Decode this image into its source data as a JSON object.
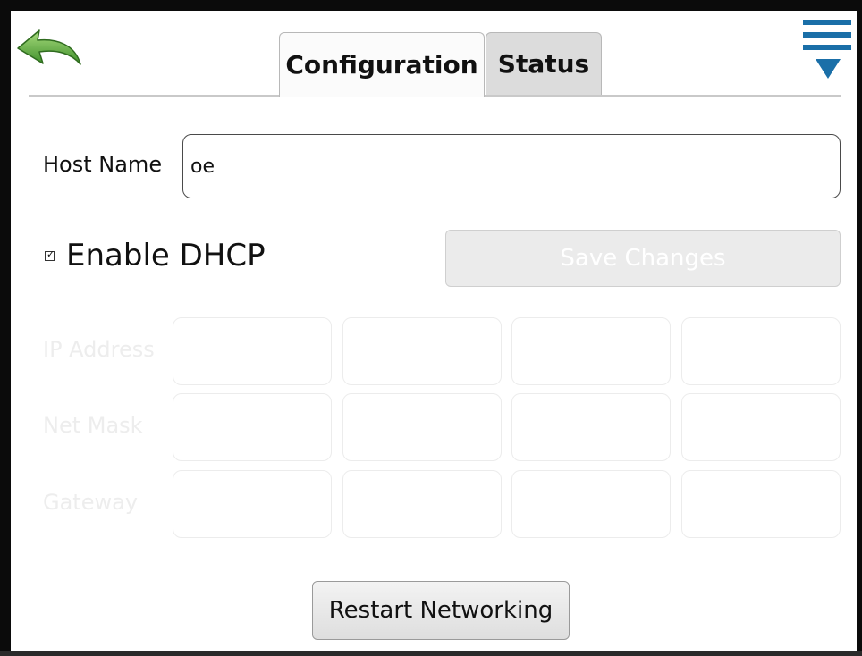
{
  "header": {
    "back_icon": "back-arrow-icon",
    "menu_icon": "menu-icon",
    "tabs": [
      {
        "label": "Configuration",
        "active": true
      },
      {
        "label": "Status",
        "active": false
      }
    ]
  },
  "form": {
    "host_name": {
      "label": "Host Name",
      "value": "oe"
    },
    "dhcp": {
      "label": "Enable DHCP",
      "checked": true
    },
    "save_button": {
      "label": "Save Changes",
      "enabled": false
    },
    "ip_address": {
      "label": "IP Address",
      "octets": [
        "",
        "",
        "",
        ""
      ],
      "enabled": false
    },
    "net_mask": {
      "label": "Net Mask",
      "octets": [
        "",
        "",
        "",
        ""
      ],
      "enabled": false
    },
    "gateway": {
      "label": "Gateway",
      "octets": [
        "",
        "",
        "",
        ""
      ],
      "enabled": false
    },
    "restart_button": {
      "label": "Restart Networking"
    }
  },
  "colors": {
    "back_arrow": "#5aa83a",
    "menu_icon": "#1a6fa8",
    "disabled_text": "#ededed"
  }
}
